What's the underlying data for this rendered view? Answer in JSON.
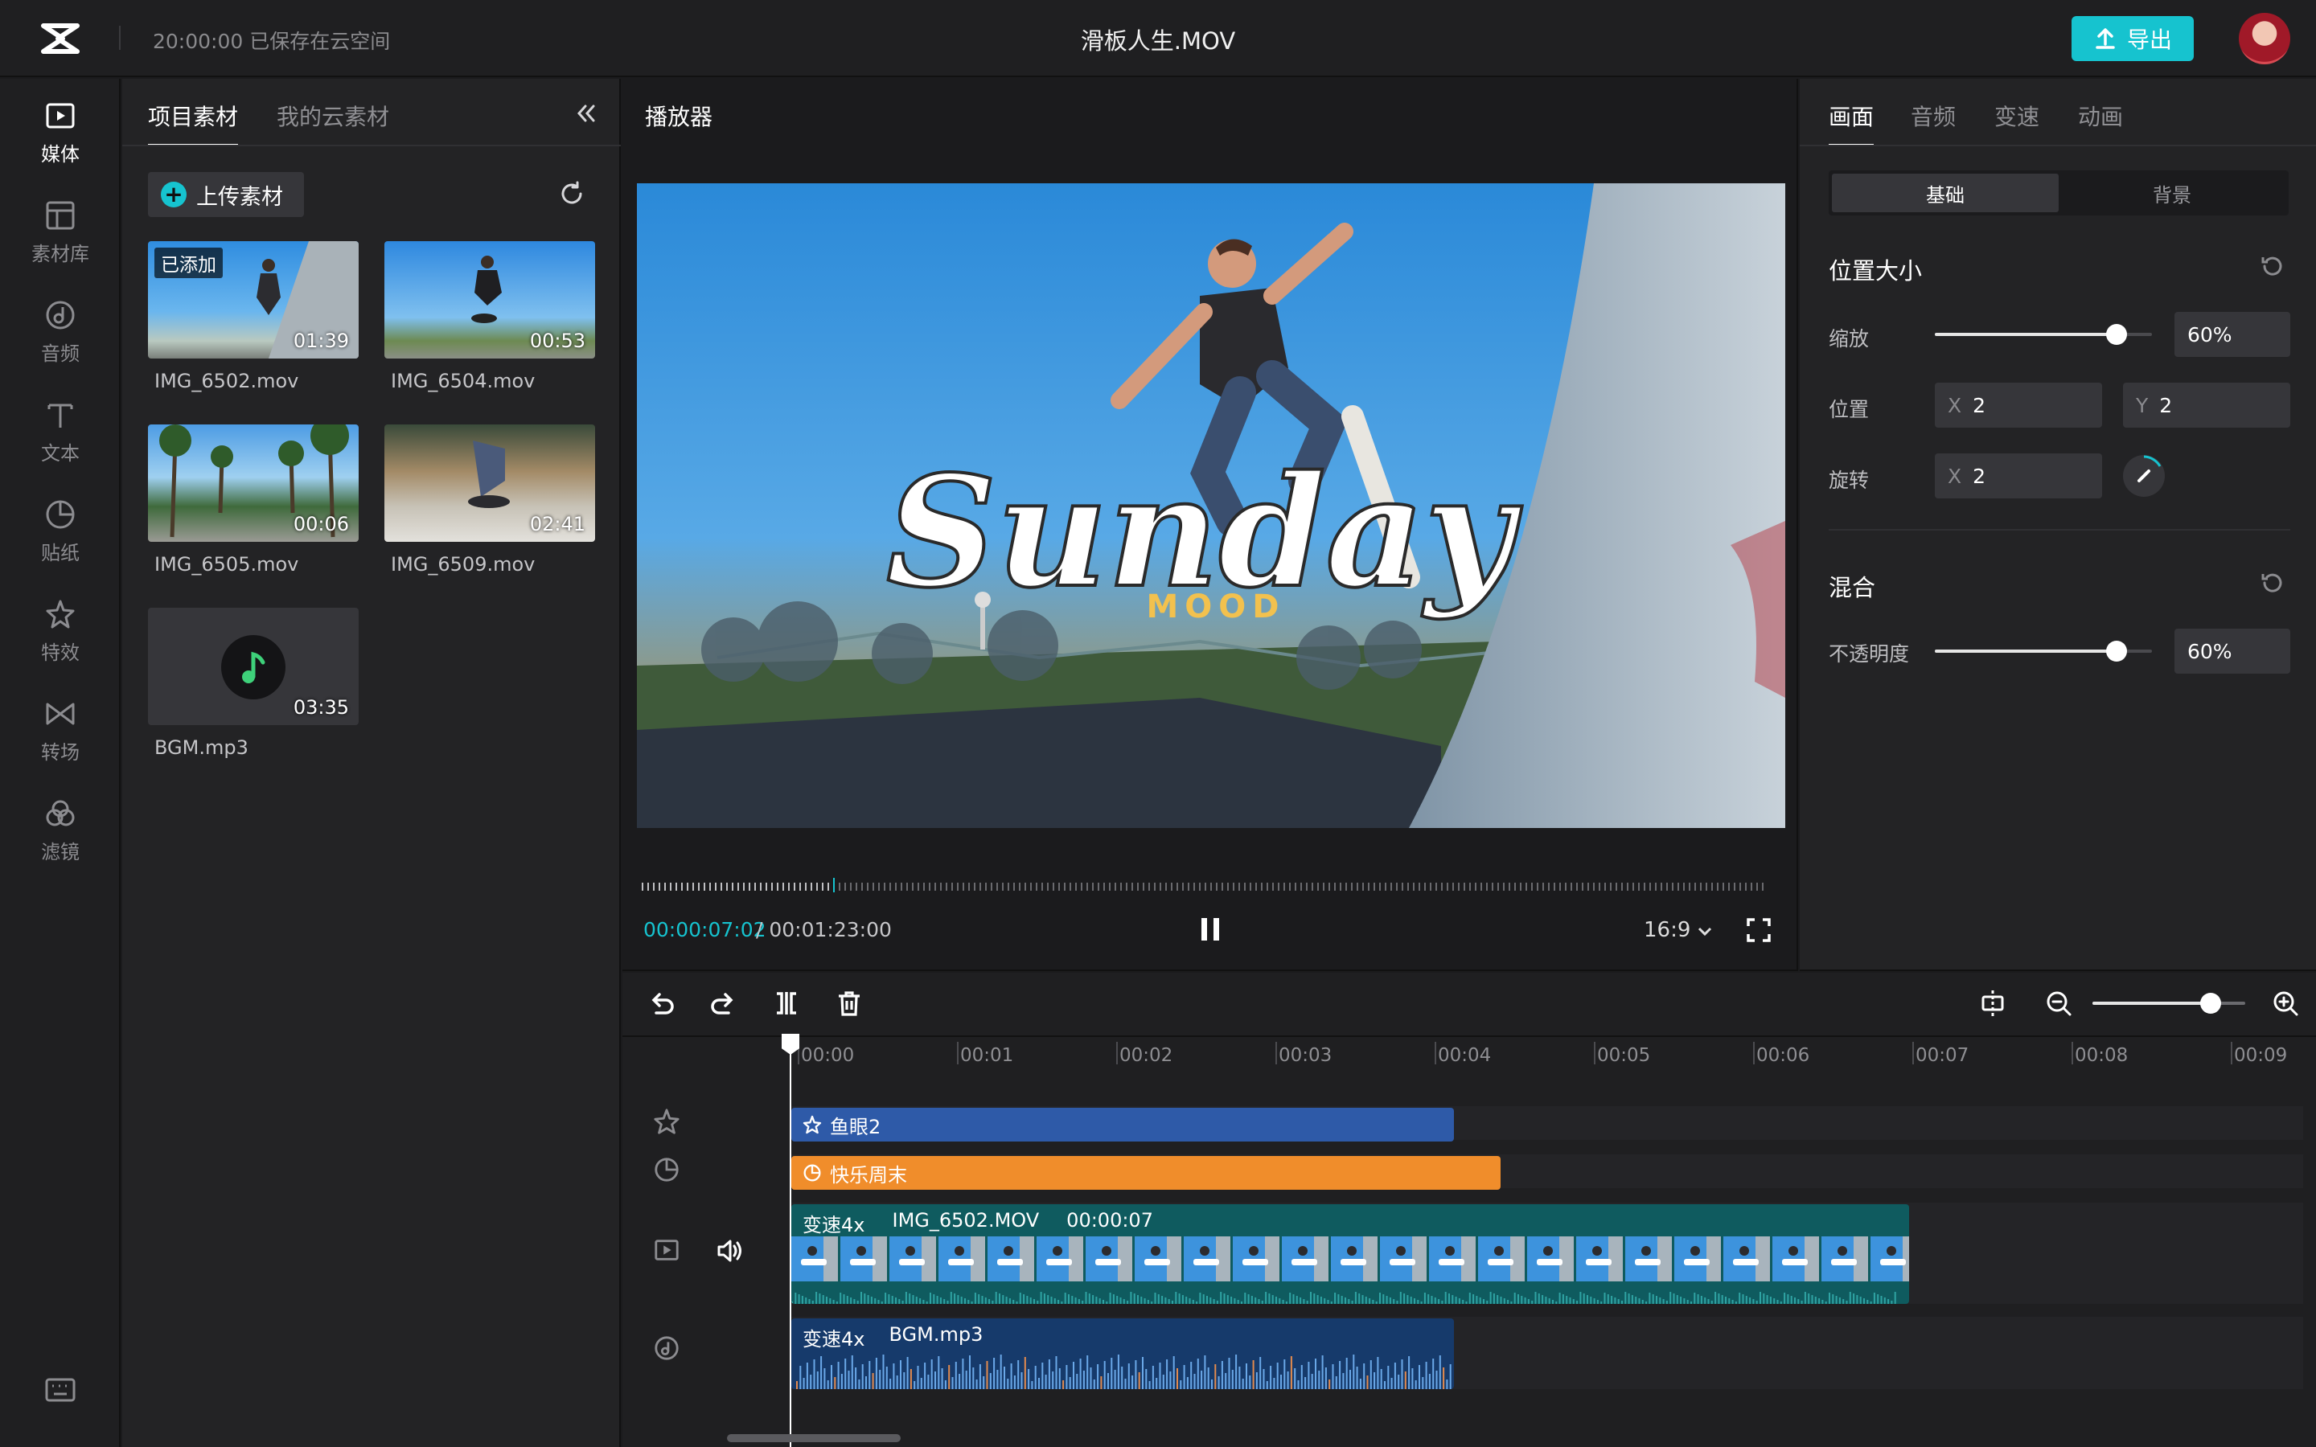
{
  "header": {
    "save_status": "20:00:00 已保存在云空间",
    "title": "滑板人生.MOV",
    "export_label": "导出"
  },
  "rail": {
    "items": [
      {
        "label": "媒体",
        "icon": "media-icon",
        "active": true
      },
      {
        "label": "素材库",
        "icon": "library-icon"
      },
      {
        "label": "音频",
        "icon": "audio-icon"
      },
      {
        "label": "文本",
        "icon": "text-icon"
      },
      {
        "label": "贴纸",
        "icon": "sticker-icon"
      },
      {
        "label": "特效",
        "icon": "effects-icon"
      },
      {
        "label": "转场",
        "icon": "transition-icon"
      },
      {
        "label": "滤镜",
        "icon": "filter-icon"
      }
    ]
  },
  "media": {
    "tabs": [
      "项目素材",
      "我的云素材"
    ],
    "upload_label": "上传素材",
    "added_tag": "已添加",
    "items": [
      {
        "name": "IMG_6502.mov",
        "duration": "01:39"
      },
      {
        "name": "IMG_6504.mov",
        "duration": "00:53"
      },
      {
        "name": "IMG_6505.mov",
        "duration": "00:06"
      },
      {
        "name": "IMG_6509.mov",
        "duration": "02:41"
      },
      {
        "name": "BGM.mp3",
        "duration": "03:35"
      }
    ]
  },
  "player": {
    "label": "播放器",
    "overlay_title": "Sunday",
    "overlay_sub": "MOOD",
    "time_current": "00:00:07:02",
    "time_total": "/ 00:01:23:00",
    "ratio": "16:9"
  },
  "props": {
    "tabs": [
      "画面",
      "音频",
      "变速",
      "动画"
    ],
    "segments": [
      "基础",
      "背景"
    ],
    "section_position": "位置大小",
    "scale_label": "缩放",
    "scale_value": "60%",
    "position_label": "位置",
    "pos_x_axis": "X",
    "pos_x": "2",
    "pos_y_axis": "Y",
    "pos_y": "2",
    "rotate_label": "旋转",
    "rot_axis": "X",
    "rot_x": "2",
    "section_blend": "混合",
    "opacity_label": "不透明度",
    "opacity_value": "60%"
  },
  "timeline": {
    "ruler": [
      "00:00",
      "00:01",
      "00:02",
      "00:03",
      "00:04",
      "00:05",
      "00:06",
      "00:07",
      "00:08",
      "00:09"
    ],
    "effect_clip": "鱼眼2",
    "sticker_clip": "快乐周末",
    "video_clip": {
      "speed": "变速4x",
      "name": "IMG_6502.MOV",
      "duration": "00:00:07"
    },
    "audio_clip": {
      "speed": "变速4x",
      "name": "BGM.mp3"
    }
  }
}
